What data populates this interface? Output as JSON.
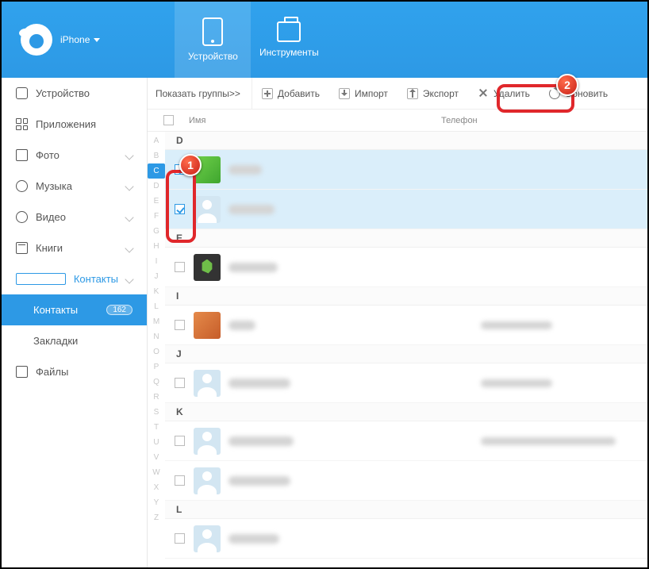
{
  "header": {
    "device": "iPhone",
    "tabs": {
      "device": "Устройство",
      "tools": "Инструменты"
    }
  },
  "sidebar": {
    "device": "Устройство",
    "apps": "Приложения",
    "photo": "Фото",
    "music": "Музыка",
    "video": "Видео",
    "books": "Книги",
    "contacts": "Контакты",
    "contacts_sub": "Контакты",
    "contacts_count": "162",
    "bookmarks": "Закладки",
    "files": "Файлы"
  },
  "toolbar": {
    "groups": "Показать группы>>",
    "add": "Добавить",
    "import": "Импорт",
    "export": "Экспорт",
    "delete": "Удалить",
    "refresh": "Обновить"
  },
  "cols": {
    "name": "Имя",
    "phone": "Телефон"
  },
  "az": [
    "A",
    "B",
    "C",
    "D",
    "E",
    "F",
    "G",
    "H",
    "I",
    "J",
    "K",
    "L",
    "M",
    "N",
    "O",
    "P",
    "Q",
    "R",
    "S",
    "T",
    "U",
    "V",
    "W",
    "X",
    "Y",
    "Z"
  ],
  "az_active": "C",
  "letters_visible": [
    "D",
    "E",
    "I",
    "J",
    "K",
    "L"
  ],
  "callouts": {
    "1": "1",
    "2": "2"
  }
}
